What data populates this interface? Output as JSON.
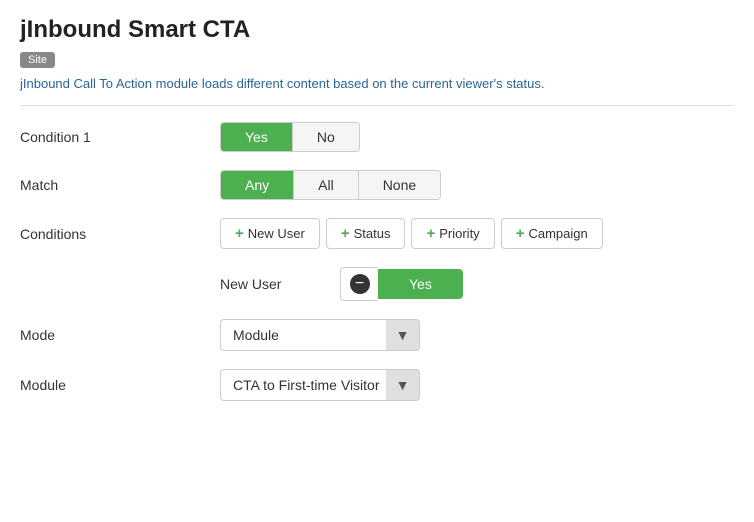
{
  "page": {
    "title": "jInbound Smart CTA",
    "badge": "Site",
    "description": "jInbound Call To Action module loads different content based on the current viewer's status."
  },
  "form": {
    "condition1": {
      "label": "Condition 1",
      "options": [
        "Yes",
        "No"
      ],
      "active": "Yes"
    },
    "match": {
      "label": "Match",
      "options": [
        "Any",
        "All",
        "None"
      ],
      "active": "Any"
    },
    "conditions": {
      "label": "Conditions",
      "buttons": [
        "New User",
        "Status",
        "Priority",
        "Campaign"
      ]
    },
    "newUser": {
      "label": "New User",
      "value": "Yes",
      "removeIcon": "−"
    },
    "mode": {
      "label": "Mode",
      "options": [
        "Module"
      ],
      "selected": "Module",
      "placeholder": "Module"
    },
    "module": {
      "label": "Module",
      "options": [
        "CTA to First-time Visitor"
      ],
      "selected": "CTA to First-time Visitor",
      "placeholder": "CTA to First-time Visitor"
    }
  }
}
